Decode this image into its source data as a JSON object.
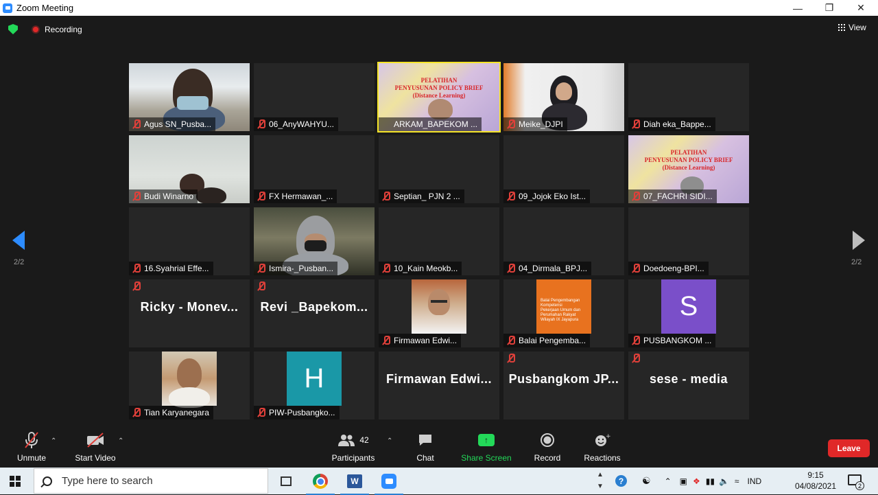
{
  "window": {
    "title": "Zoom Meeting"
  },
  "status": {
    "recording_label": "Recording",
    "view_label": "View"
  },
  "pagination": {
    "left": "2/2",
    "right": "2/2"
  },
  "tiles": [
    {
      "name": "Agus SN_Pusba...",
      "kind": "video"
    },
    {
      "name": "06_AnyWAHYU...",
      "kind": "blank"
    },
    {
      "name": "ARKAM_BAPEKOM ...",
      "kind": "video",
      "active": true
    },
    {
      "name": "Meike_DJPI",
      "kind": "video"
    },
    {
      "name": "Diah eka_Bappe...",
      "kind": "blank"
    },
    {
      "name": "Budi Winarno",
      "kind": "video"
    },
    {
      "name": "FX Hermawan_...",
      "kind": "blank"
    },
    {
      "name": "Septian_ PJN 2 ...",
      "kind": "blank"
    },
    {
      "name": "09_Jojok Eko Ist...",
      "kind": "blank"
    },
    {
      "name": "07_FACHRI SIDI...",
      "kind": "video"
    },
    {
      "name": "16.Syahrial Effe...",
      "kind": "blank"
    },
    {
      "name": "Ismira-_Pusban...",
      "kind": "video"
    },
    {
      "name": "10_Kain Meokb...",
      "kind": "blank"
    },
    {
      "name": "04_Dirmala_BPJ...",
      "kind": "blank"
    },
    {
      "name": "Doedoeng-BPI...",
      "kind": "blank"
    },
    {
      "name": "Ricky - Monev...",
      "kind": "text"
    },
    {
      "name": "Revi _Bapekom...",
      "kind": "text"
    },
    {
      "name": "Firmawan Edwi...",
      "kind": "photo"
    },
    {
      "name": "Balai Pengemba...",
      "kind": "photo"
    },
    {
      "name": "PUSBANGKOM ...",
      "kind": "letter"
    },
    {
      "name": "Tian Karyanegara",
      "kind": "photo"
    },
    {
      "name": "PIW-Pusbangko...",
      "kind": "letter"
    },
    {
      "name": "Firmawan Edwi...",
      "kind": "text"
    },
    {
      "name": "Pusbangkom JP...",
      "kind": "text"
    },
    {
      "name": "sese - media",
      "kind": "text"
    }
  ],
  "slide": {
    "line1": "PELATIHAN",
    "line2": "PENYUSUNAN POLICY BRIEF",
    "line3": "(Distance Learning)"
  },
  "avatars": {
    "s_letter": "S",
    "h_letter": "H",
    "balai_text": "Balai Pengembangan Kompetensi Pekerjaan Umum dan Perumahan Rakyat Wilayah IX Jayapura"
  },
  "toolbar": {
    "unmute": "Unmute",
    "start_video": "Start Video",
    "participants": "Participants",
    "participants_count": "42",
    "chat": "Chat",
    "share_screen": "Share Screen",
    "record": "Record",
    "reactions": "Reactions",
    "leave": "Leave"
  },
  "taskbar": {
    "search_placeholder": "Type here to search",
    "language": "IND",
    "time": "9:15",
    "date": "04/08/2021",
    "notification_count": "2"
  },
  "colors": {
    "accent": "#2D8CFF",
    "share_green": "#23d959",
    "leave_red": "#e02828",
    "active_border": "#f5e428",
    "muted_red": "#e0403a"
  }
}
